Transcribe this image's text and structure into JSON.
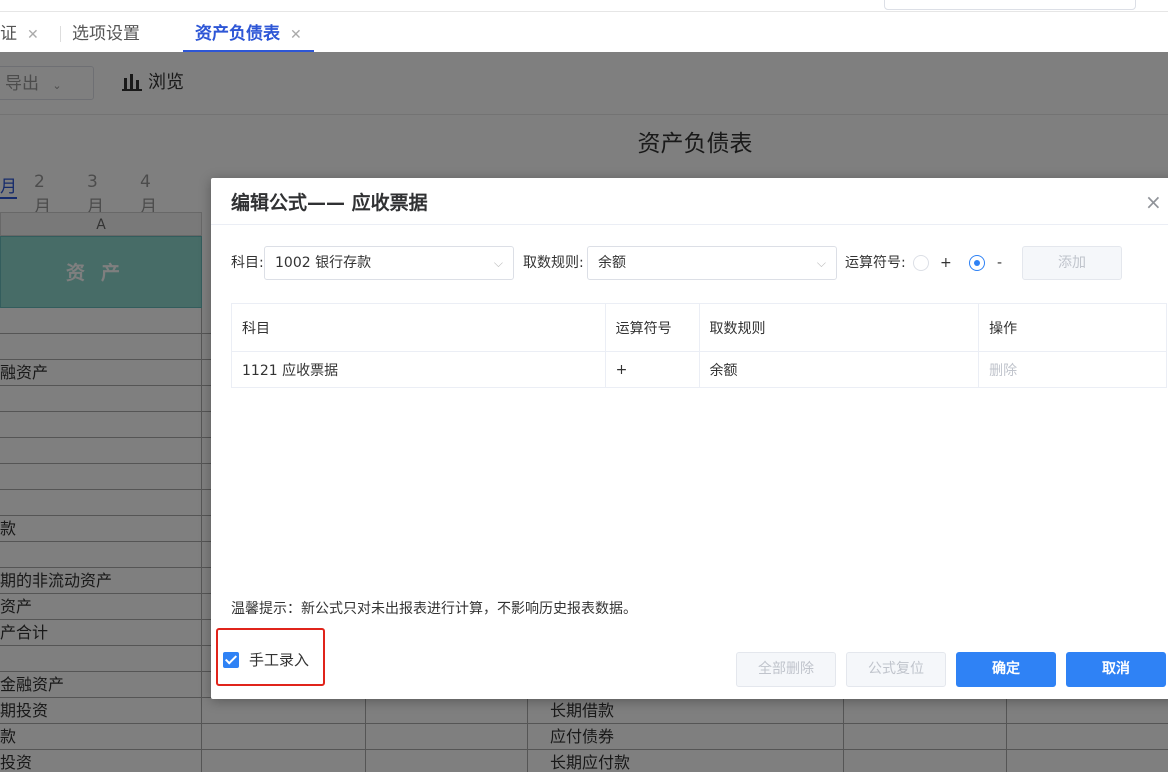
{
  "tabs": [
    {
      "label": "证",
      "closable": true
    },
    {
      "label": "选项设置",
      "closable": false
    },
    {
      "label": "资产负债表",
      "closable": true,
      "active": true
    }
  ],
  "close_glyph": "✕",
  "toolbar": {
    "export_label": "导出",
    "browse_label": "浏览"
  },
  "report": {
    "title": "资产负债表",
    "months": [
      "月",
      "2月",
      "3月",
      "4月"
    ],
    "active_month_index": 0,
    "column_a": "A",
    "asset_header": "资产"
  },
  "sheet_rows": [
    {
      "a": "",
      "d": ""
    },
    {
      "a": "",
      "d": ""
    },
    {
      "a": "融资产",
      "d": ""
    },
    {
      "a": "",
      "d": ""
    },
    {
      "a": "",
      "d": ""
    },
    {
      "a": "",
      "d": ""
    },
    {
      "a": "",
      "d": ""
    },
    {
      "a": "",
      "d": ""
    },
    {
      "a": "款",
      "d": ""
    },
    {
      "a": "",
      "d": ""
    },
    {
      "a": "期的非流动资产",
      "d": ""
    },
    {
      "a": "资产",
      "d": ""
    },
    {
      "a": "产合计",
      "d": ""
    },
    {
      "a": "",
      "d": ""
    },
    {
      "a": "金融资产",
      "d": ""
    },
    {
      "a": "期投资",
      "d": "长期借款"
    },
    {
      "a": "款",
      "d": "应付债券"
    },
    {
      "a": "投资",
      "d": "长期应付款"
    }
  ],
  "dialog": {
    "title": "编辑公式—— 应收票据",
    "close_glyph": "×",
    "subject_label": "科目:",
    "subject_value": "1002 银行存款",
    "rule_label": "取数规则:",
    "rule_value": "余额",
    "operator_label": "运算符号:",
    "operator_options": [
      "+",
      "-"
    ],
    "operator_selected": "-",
    "add_label": "添加",
    "table": {
      "headers": [
        "科目",
        "运算符号",
        "取数规则",
        "操作"
      ],
      "rows": [
        {
          "subject": "1121 应收票据",
          "operator": "+",
          "rule": "余额",
          "action": "删除"
        }
      ]
    },
    "tip": "温馨提示：新公式只对未出报表进行计算，不影响历史报表数据。",
    "manual_entry_label": "手工录入",
    "manual_entry_checked": true,
    "buttons": {
      "delete_all": "全部删除",
      "reset_formula": "公式复位",
      "confirm": "确定",
      "cancel": "取消"
    }
  },
  "colors": {
    "accent": "#2f82f5",
    "tab_active": "#2d56d6",
    "highlight_box": "#e0241b",
    "asset_header_bg": "#8fd8cf"
  }
}
